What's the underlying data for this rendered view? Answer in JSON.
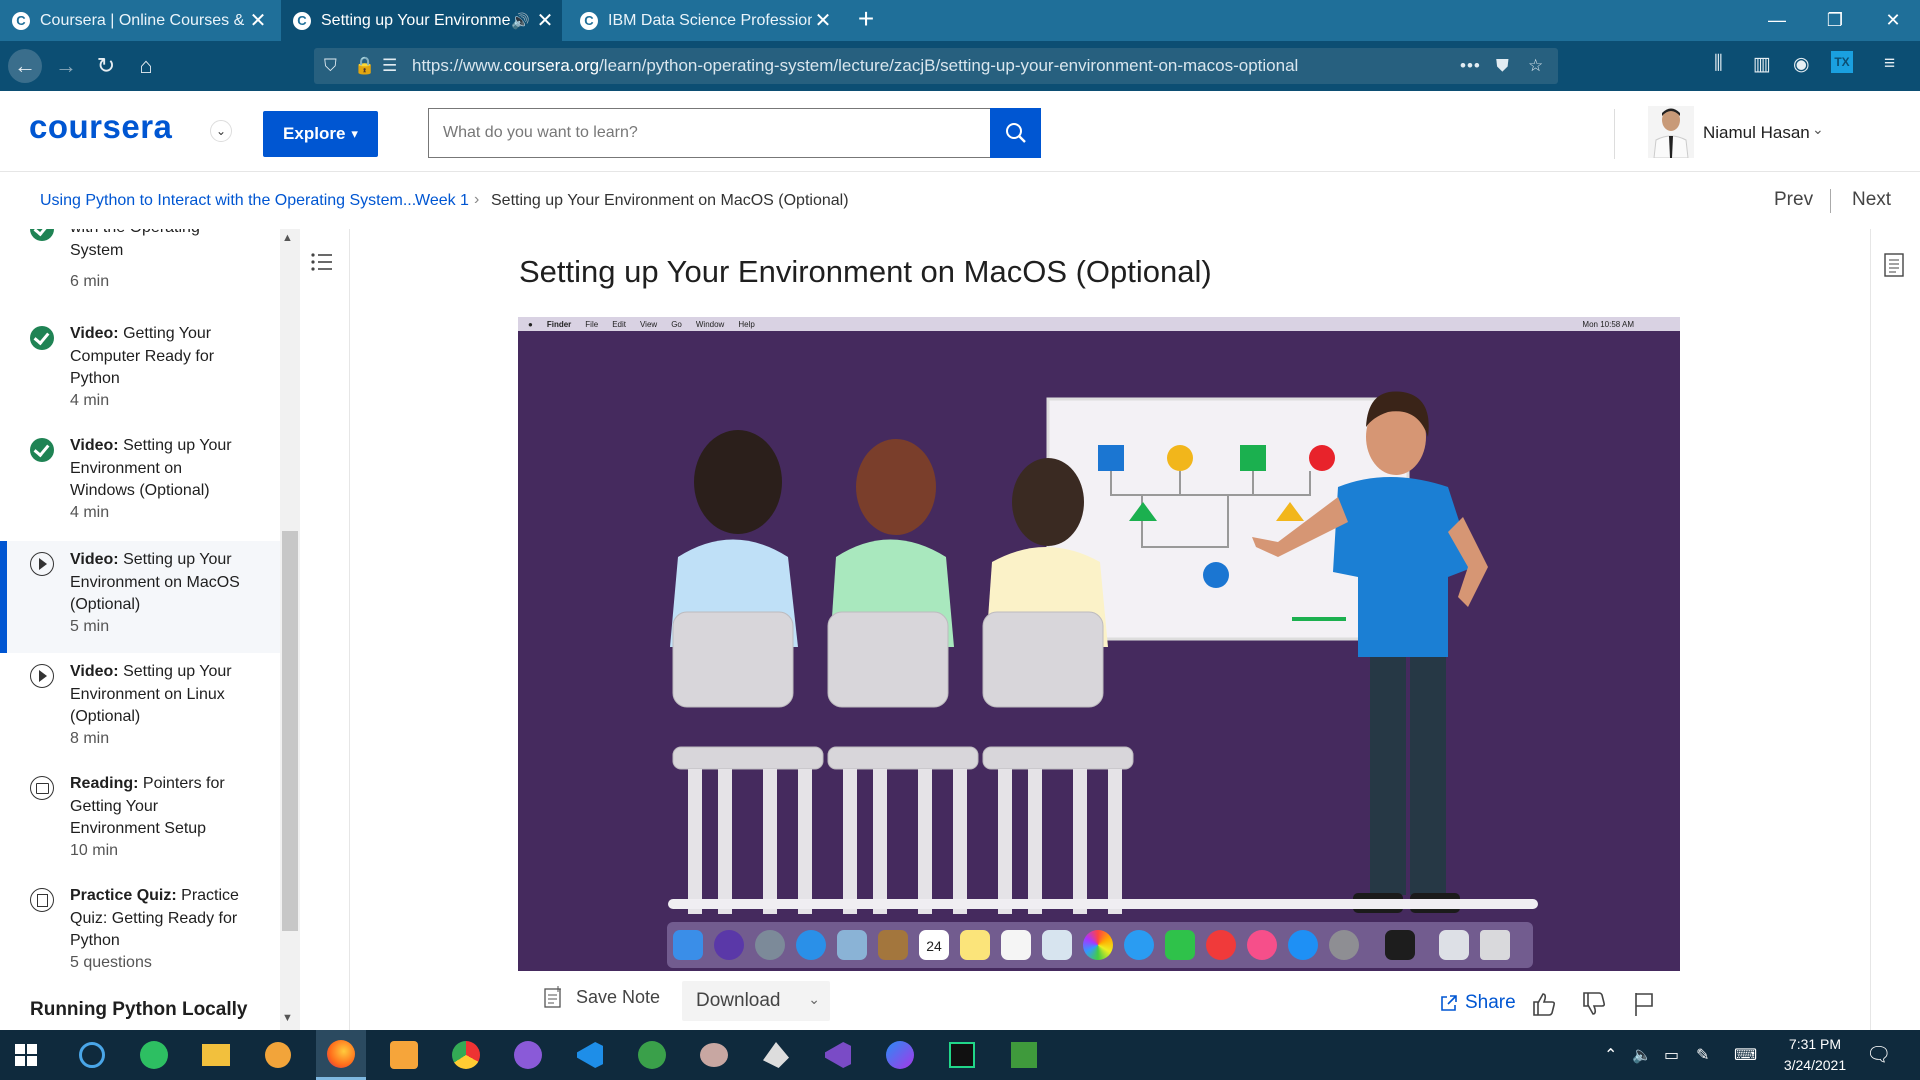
{
  "browser": {
    "tabs": [
      {
        "title": "Coursera | Online Courses & Cr",
        "favicon": "coursera-icon",
        "active": false
      },
      {
        "title": "Setting up Your Environmen",
        "favicon": "coursera-icon",
        "active": true,
        "audio": true
      },
      {
        "title": "IBM Data Science Professional",
        "favicon": "coursera-icon",
        "active": false
      }
    ],
    "favicon_letter": "C",
    "new_tab_label": "+",
    "url_prefix": "https://www.",
    "url_domain": "coursera.org",
    "url_path": "/learn/python-operating-system/lecture/zacjB/setting-up-your-environment-on-macos-optional",
    "overflow_menu": "•••",
    "colors": {
      "tabstrip": "#1f6f99",
      "navbar": "#0c4e73"
    }
  },
  "header": {
    "logo": "coursera",
    "explore_label": "Explore",
    "search_placeholder": "What do you want to learn?",
    "user_name": "Niamul Hasan",
    "brand_color": "#0056d2"
  },
  "breadcrumb": {
    "course": "Using Python to Interact with the Operating System...",
    "week": "Week 1",
    "separator": "›",
    "current": "Setting up Your Environment on MacOS (Optional)",
    "prev_label": "Prev",
    "next_label": "Next"
  },
  "sidebar": {
    "items": [
      {
        "type_label": "",
        "title": "with the Operating System",
        "duration": "6 min",
        "status": "done"
      },
      {
        "type_label": "Video:",
        "title": "Getting Your Computer Ready for Python",
        "duration": "4 min",
        "status": "done"
      },
      {
        "type_label": "Video:",
        "title": "Setting up Your Environment on Windows (Optional)",
        "duration": "4 min",
        "status": "done"
      },
      {
        "type_label": "Video:",
        "title": "Setting up Your Environment on MacOS (Optional)",
        "duration": "5 min",
        "status": "current"
      },
      {
        "type_label": "Video:",
        "title": "Setting up Your Environment on Linux (Optional)",
        "duration": "8 min",
        "status": "video"
      },
      {
        "type_label": "Reading:",
        "title": "Pointers for Getting Your Environment Setup",
        "duration": "10 min",
        "status": "reading"
      },
      {
        "type_label": "Practice Quiz:",
        "title": "Practice Quiz: Getting Ready for Python",
        "duration": "5 questions",
        "status": "quiz"
      }
    ],
    "next_section": "Running Python Locally",
    "scroll_up": "▲",
    "scroll_down": "▼"
  },
  "main": {
    "title": "Setting up Your Environment on MacOS (Optional)",
    "video": {
      "menubar": [
        "Finder",
        "File",
        "Edit",
        "View",
        "Go",
        "Window",
        "Help"
      ],
      "menubar_clock": "Mon 10:58 AM",
      "calendar_day": "24",
      "background": "#452a5e"
    },
    "save_note_label": "Save Note",
    "download_label": "Download",
    "share_label": "Share"
  },
  "taskbar": {
    "time": "7:31 PM",
    "date": "3/24/2021"
  }
}
